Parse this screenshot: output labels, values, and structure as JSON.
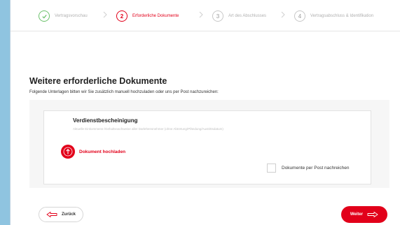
{
  "steps": [
    {
      "number": "",
      "label": "Vertragsvorschau",
      "state": "done"
    },
    {
      "number": "2",
      "label": "Erforderliche Dokumente",
      "state": "active"
    },
    {
      "number": "3",
      "label": "Art des Abschlusses",
      "state": "pending"
    },
    {
      "number": "4",
      "label": "Vertragsabschluss & Identifikation",
      "state": "pending"
    }
  ],
  "section": {
    "title": "Weitere erforderliche Dokumente",
    "subtitle": "Folgende Unterlagen bitten wir Sie zusätzlich manuell hochzuladen oder uns per Post nachzureichen:"
  },
  "document": {
    "title": "Verdienstbescheinigung",
    "description": "Aktuelle Einkommens-/Gehaltsnachweise aller Darlehensnehmer (ohne Abtretung/Pfändung/Austrittsdatum)",
    "upload_label": "Dokument hochladen",
    "post_label": "Dokumente per Post nachreichen",
    "post_checked": false
  },
  "footer": {
    "back_label": "Zurück",
    "next_label": "Weiter"
  },
  "colors": {
    "accent": "#e2001a",
    "done": "#6cc16b",
    "frame_bg": "#8fc4e0"
  }
}
